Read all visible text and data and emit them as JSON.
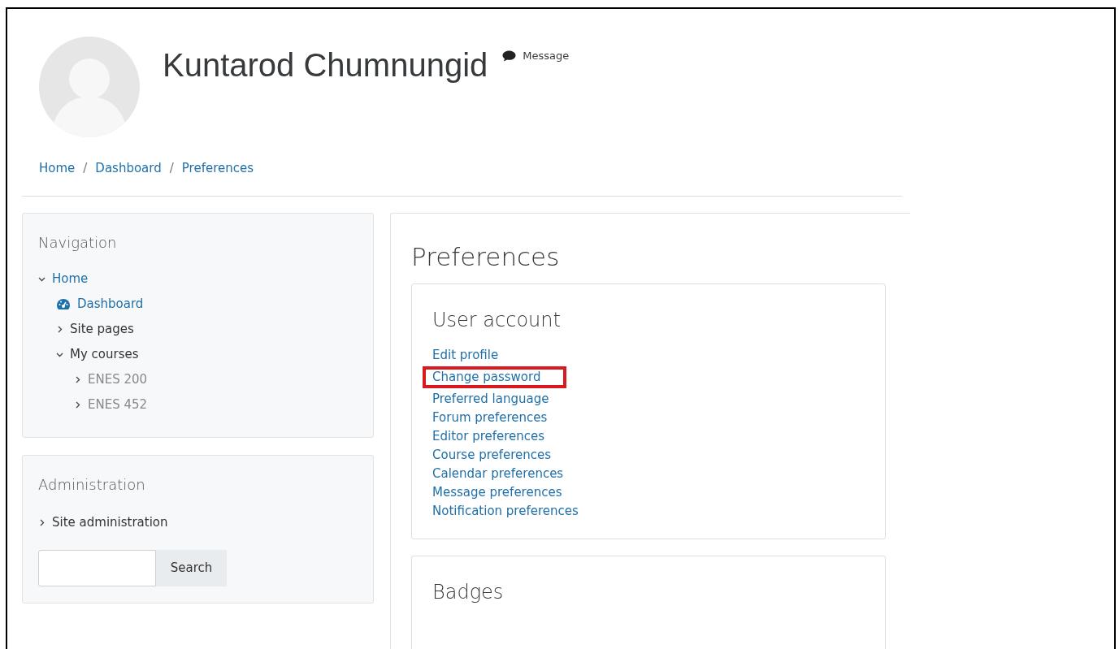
{
  "profile": {
    "name": "Kuntarod Chumnungid",
    "message_link": "Message"
  },
  "breadcrumb": {
    "separator": "/",
    "items": [
      "Home",
      "Dashboard",
      "Preferences"
    ]
  },
  "navigation": {
    "title": "Navigation",
    "items": [
      {
        "label": "Home",
        "kind": "link",
        "expanded": true,
        "children": [
          {
            "label": "Dashboard",
            "kind": "dashboard"
          },
          {
            "label": "Site pages",
            "kind": "branch",
            "expanded": false
          },
          {
            "label": "My courses",
            "kind": "branch",
            "expanded": true,
            "children": [
              {
                "label": "ENES 200",
                "kind": "course",
                "expanded": false
              },
              {
                "label": "ENES 452",
                "kind": "course",
                "expanded": false
              }
            ]
          }
        ]
      }
    ]
  },
  "administration": {
    "title": "Administration",
    "items": [
      {
        "label": "Site administration",
        "kind": "branch",
        "expanded": false
      }
    ],
    "search_button": "Search"
  },
  "main": {
    "title": "Preferences",
    "sections": [
      {
        "title": "User account",
        "links": [
          {
            "label": "Edit profile",
            "highlighted": false
          },
          {
            "label": "Change password",
            "highlighted": true
          },
          {
            "label": "Preferred language",
            "highlighted": false
          },
          {
            "label": "Forum preferences",
            "highlighted": false
          },
          {
            "label": "Editor preferences",
            "highlighted": false
          },
          {
            "label": "Course preferences",
            "highlighted": false
          },
          {
            "label": "Calendar preferences",
            "highlighted": false
          },
          {
            "label": "Message preferences",
            "highlighted": false
          },
          {
            "label": "Notification preferences",
            "highlighted": false
          }
        ]
      },
      {
        "title": "Badges"
      }
    ]
  }
}
